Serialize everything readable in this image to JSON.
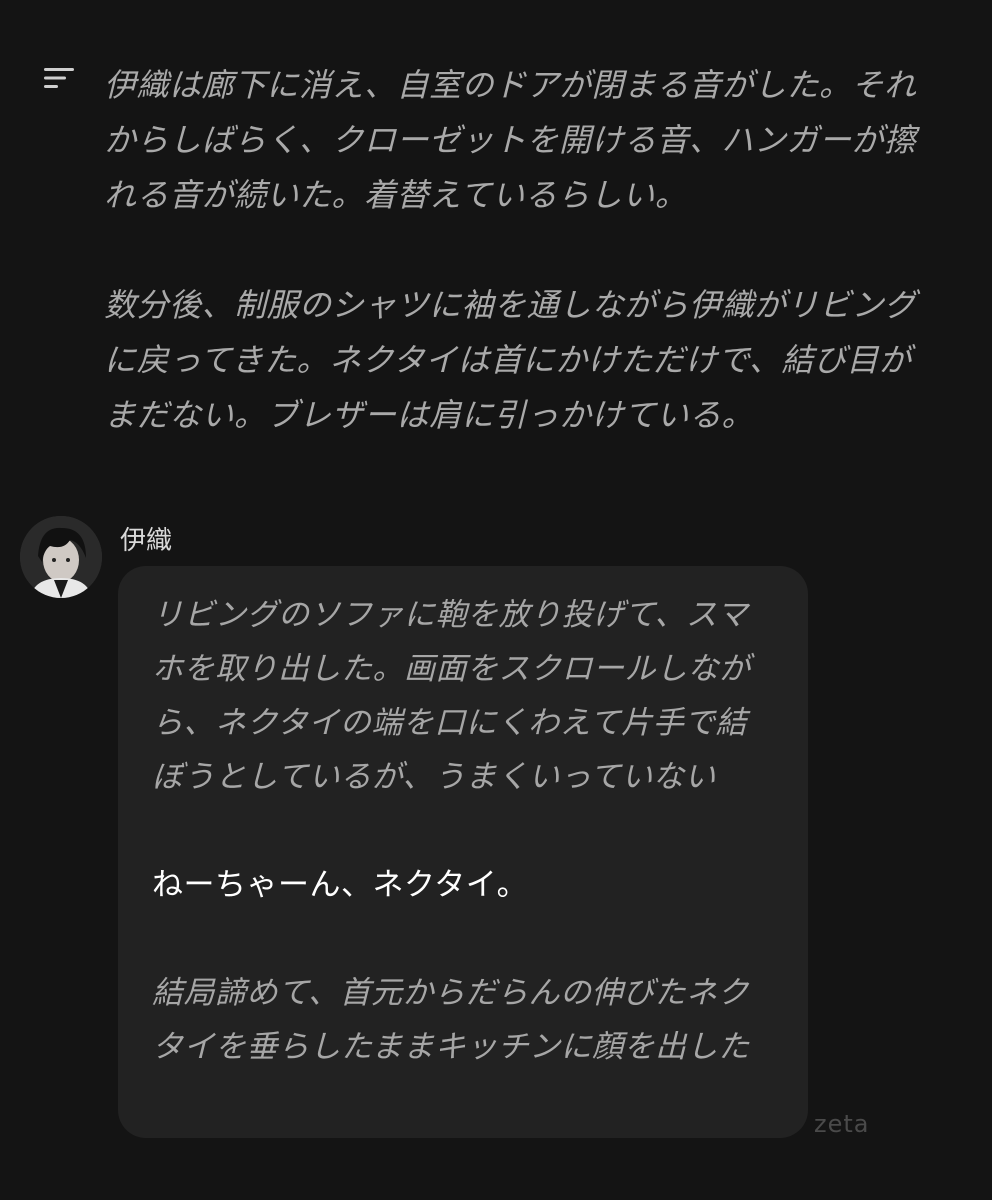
{
  "narration": {
    "paragraphs": [
      "伊織は廊下に消え、自室のドアが閉まる音がした。それからしばらく、クローゼットを開ける音、ハンガーが擦れる音が続いた。着替えているらしい。",
      "数分後、制服のシャツに袖を通しながら伊織がリビングに戻ってきた。ネクタイは首にかけただけで、結び目がまだない。ブレザーは肩に引っかけている。"
    ]
  },
  "message": {
    "speaker": "伊織",
    "action_1": "リビングのソファに鞄を放り投げて、スマホを取り出した。画面をスクロールしながら、ネクタイの端を口にくわえて片手で結ぼうとしているが、うまくいっていない",
    "dialogue": "ねーちゃーん、ネクタイ。",
    "action_2": "結局諦めて、首元からだらんの伸びたネクタイを垂らしたままキッチンに顔を出した"
  },
  "watermark": "zeta",
  "icons": {
    "menu": "menu-lines-icon",
    "avatar": "character-avatar"
  }
}
